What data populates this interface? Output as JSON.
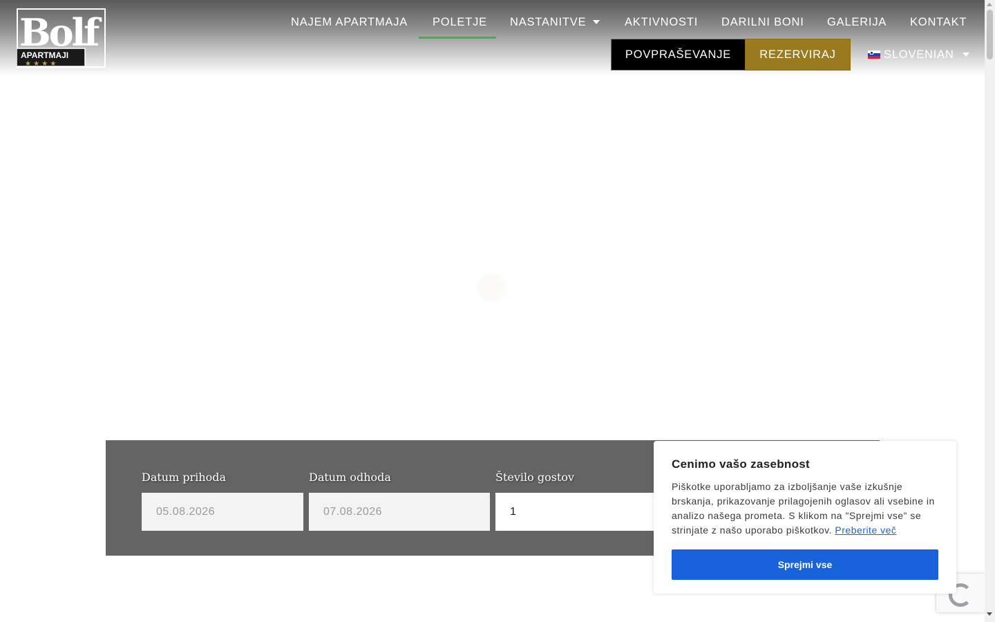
{
  "header": {
    "logo": {
      "wordmark": "Bolf",
      "subtitle": "APARTMAJI",
      "stars": "★ ★ ★ ★"
    },
    "nav": {
      "items": [
        {
          "label": "NAJEM APARTMAJA",
          "active": false,
          "dropdown": false
        },
        {
          "label": "POLETJE",
          "active": true,
          "dropdown": false
        },
        {
          "label": "NASTANITVE",
          "active": false,
          "dropdown": true
        },
        {
          "label": "AKTIVNOSTI",
          "active": false,
          "dropdown": false
        },
        {
          "label": "DARILNI BONI",
          "active": false,
          "dropdown": false
        },
        {
          "label": "GALERIJA",
          "active": false,
          "dropdown": false
        },
        {
          "label": "KONTAKT",
          "active": false,
          "dropdown": false
        }
      ]
    },
    "buttons": {
      "inquiry": "POVPRAŠEVANJE",
      "reserve": "REZERVIRAJ"
    },
    "language": {
      "label": "SLOVENIAN",
      "flag_icon": "slovenia-flag-icon"
    }
  },
  "booking": {
    "arrival_label": "Datum prihoda",
    "arrival_value": "05.08.2026",
    "departure_label": "Datum odhoda",
    "departure_value": "07.08.2026",
    "guests_label": "Število gostov",
    "guests_value": "1"
  },
  "cookie": {
    "title": "Cenimo vašo zasebnost",
    "text": "Piškotke uporabljamo za izboljšanje vaše izkušnje brskanja, prikazovanje prilagojenih oglasov ali vsebine in analizo našega prometa. S klikom na \"Sprejmi vse\" se strinjate z našo uporabo piškotkov.",
    "link": "Preberite več",
    "accept": "Sprejmi vse"
  },
  "colors": {
    "accent_gold": "#9a7a1e",
    "nav_active_underline": "#3fb34a",
    "cookie_button": "#1863dc",
    "booking_bar": "#646464"
  }
}
